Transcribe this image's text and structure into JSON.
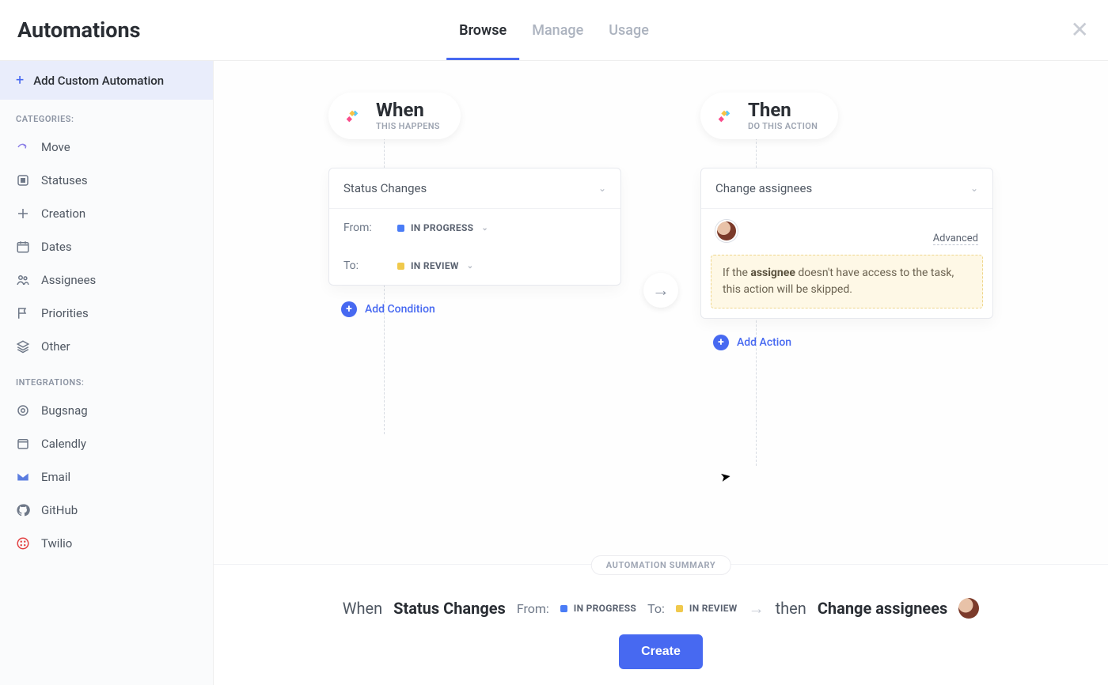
{
  "header": {
    "title": "Automations",
    "tabs": [
      {
        "label": "Browse",
        "active": true
      },
      {
        "label": "Manage",
        "active": false
      },
      {
        "label": "Usage",
        "active": false
      }
    ]
  },
  "sidebar": {
    "add_custom_label": "Add Custom Automation",
    "categories_heading": "CATEGORIES:",
    "categories": [
      {
        "icon": "arrow-share-icon",
        "label": "Move"
      },
      {
        "icon": "square-icon",
        "label": "Statuses"
      },
      {
        "icon": "plus-outline-icon",
        "label": "Creation"
      },
      {
        "icon": "calendar-icon",
        "label": "Dates"
      },
      {
        "icon": "people-icon",
        "label": "Assignees"
      },
      {
        "icon": "flag-icon",
        "label": "Priorities"
      },
      {
        "icon": "layers-icon",
        "label": "Other"
      }
    ],
    "integrations_heading": "INTEGRATIONS:",
    "integrations": [
      {
        "icon": "bugsnag-icon",
        "label": "Bugsnag"
      },
      {
        "icon": "calendly-icon",
        "label": "Calendly"
      },
      {
        "icon": "email-icon",
        "label": "Email"
      },
      {
        "icon": "github-icon",
        "label": "GitHub"
      },
      {
        "icon": "twilio-icon",
        "label": "Twilio"
      }
    ]
  },
  "flow": {
    "when": {
      "title": "When",
      "subtitle": "THIS HAPPENS",
      "trigger_label": "Status Changes",
      "from_label": "From:",
      "from_status": "IN PROGRESS",
      "from_color": "#4a7cf6",
      "to_label": "To:",
      "to_status": "IN REVIEW",
      "to_color": "#f0c94c",
      "add_condition_label": "Add Condition"
    },
    "then": {
      "title": "Then",
      "subtitle": "DO THIS ACTION",
      "action_label": "Change assignees",
      "advanced_label": "Advanced",
      "warning_prefix": "If the ",
      "warning_bold": "assignee",
      "warning_suffix": " doesn't have access to the task, this action will be skipped.",
      "add_action_label": "Add Action"
    }
  },
  "summary": {
    "badge": "AUTOMATION SUMMARY",
    "when_word": "When",
    "trigger": "Status Changes",
    "from_label": "From:",
    "from_status": "IN PROGRESS",
    "to_label": "To:",
    "to_status": "IN REVIEW",
    "then_word": "then",
    "action": "Change assignees",
    "create_label": "Create"
  }
}
